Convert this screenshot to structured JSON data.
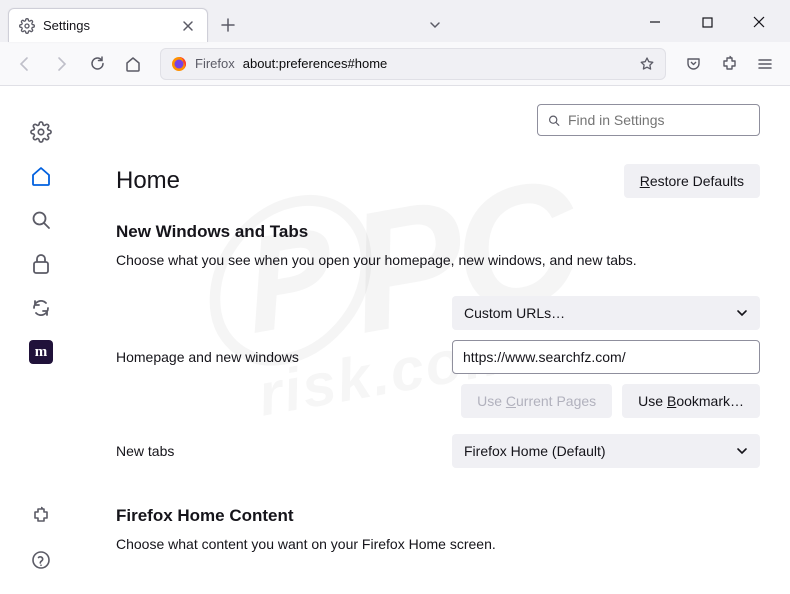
{
  "tab": {
    "title": "Settings"
  },
  "url": {
    "label": "Firefox",
    "path": "about:preferences#home"
  },
  "search": {
    "placeholder": "Find in Settings"
  },
  "page": {
    "title": "Home",
    "restore": "Restore Defaults",
    "section1": {
      "heading": "New Windows and Tabs",
      "desc": "Choose what you see when you open your homepage, new windows, and new tabs."
    },
    "homepage": {
      "label": "Homepage and new windows",
      "select": "Custom URLs…",
      "url": "https://www.searchfz.com/",
      "use_current": "Use Current Pages",
      "use_bookmark": "Use Bookmark…"
    },
    "newtabs": {
      "label": "New tabs",
      "select": "Firefox Home (Default)"
    },
    "section2": {
      "heading": "Firefox Home Content",
      "desc": "Choose what content you want on your Firefox Home screen."
    }
  }
}
